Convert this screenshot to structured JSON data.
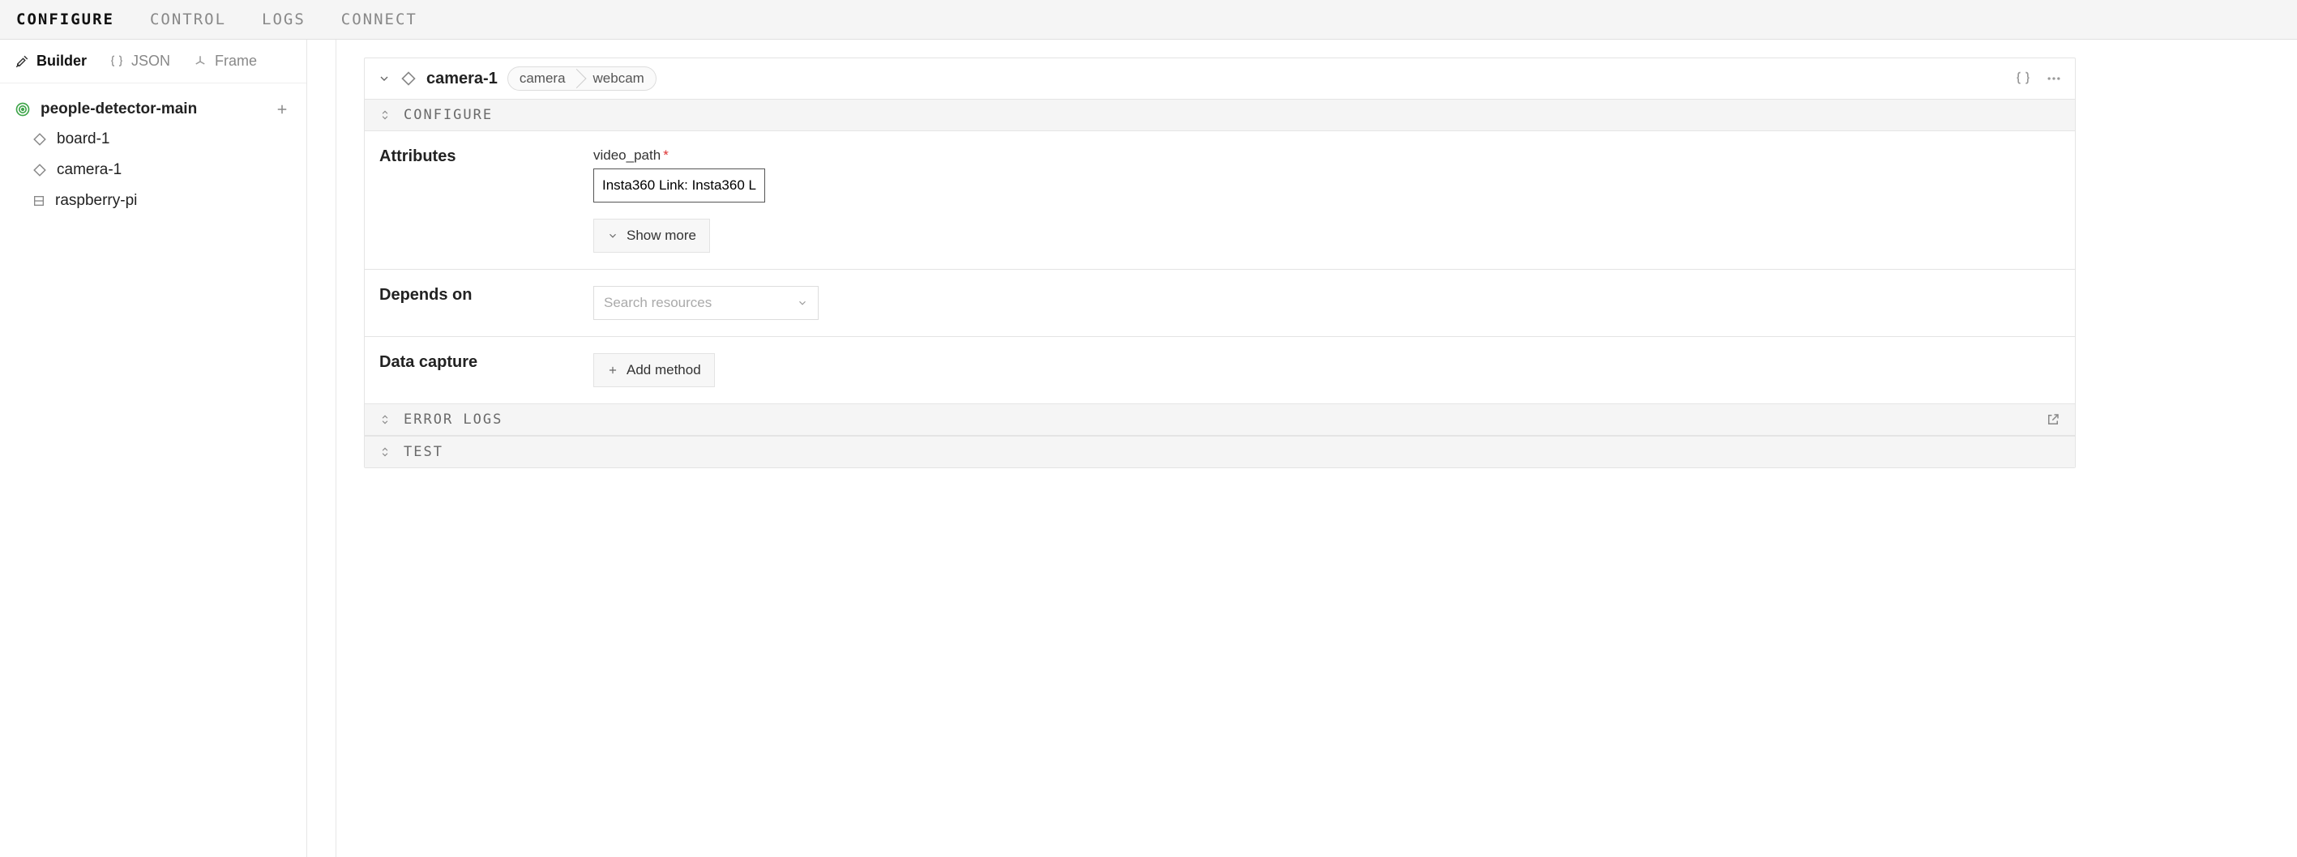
{
  "tabs": {
    "configure": "CONFIGURE",
    "control": "CONTROL",
    "logs": "LOGS",
    "connect": "CONNECT"
  },
  "subtabs": {
    "builder": "Builder",
    "json": "JSON",
    "frame": "Frame"
  },
  "sidebar": {
    "root": "people-detector-main",
    "items": [
      {
        "label": "board-1"
      },
      {
        "label": "camera-1"
      },
      {
        "label": "raspberry-pi"
      }
    ]
  },
  "resource": {
    "name": "camera-1",
    "breadcrumb": {
      "type": "camera",
      "model": "webcam"
    },
    "sections": {
      "configure": {
        "title": "CONFIGURE",
        "attributes_label": "Attributes",
        "video_path_label": "video_path",
        "video_path_value": "Insta360 Link: Insta360 L",
        "show_more": "Show more",
        "depends_label": "Depends on",
        "depends_placeholder": "Search resources",
        "data_capture_label": "Data capture",
        "add_method": "Add method"
      },
      "error_logs": {
        "title": "ERROR LOGS"
      },
      "test": {
        "title": "TEST"
      }
    }
  }
}
